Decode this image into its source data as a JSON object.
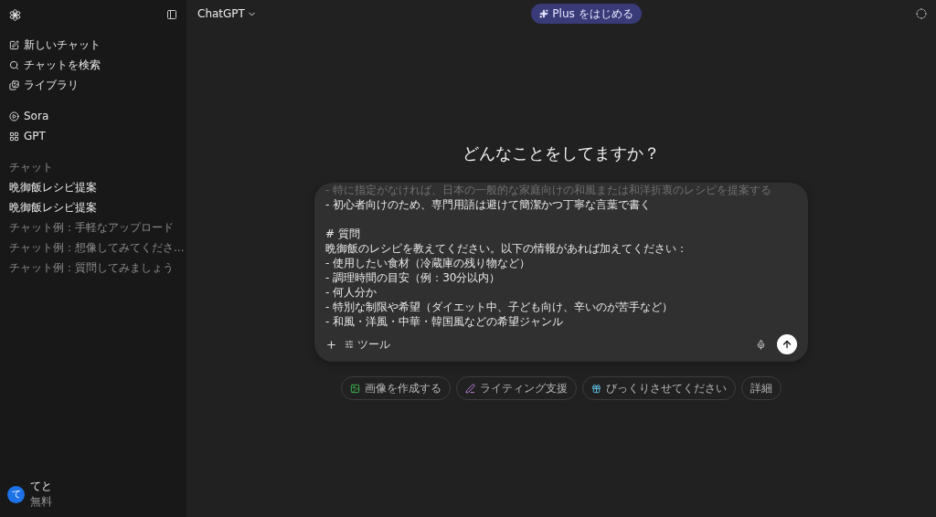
{
  "sidebar": {
    "nav": [
      {
        "label": "新しいチャット"
      },
      {
        "label": "チャットを検索"
      },
      {
        "label": "ライブラリ"
      }
    ],
    "apps": [
      {
        "label": "Sora"
      },
      {
        "label": "GPT"
      }
    ],
    "chats_heading": "チャット",
    "chats": [
      {
        "label": "晩御飯レシピ提案",
        "muted": false
      },
      {
        "label": "晩御飯レシピ提案",
        "muted": false
      },
      {
        "label": "チャット例：手軽なアップロード",
        "muted": true
      },
      {
        "label": "チャット例：想像してみてくださ...",
        "muted": true
      },
      {
        "label": "チャット例：質問してみましょう",
        "muted": true
      }
    ],
    "user": {
      "initial": "て",
      "name": "てと",
      "plan": "無料"
    }
  },
  "header": {
    "model": "ChatGPT",
    "upgrade": "Plus をはじめる"
  },
  "main": {
    "heading": "どんなことをしてますか？",
    "prompt_paragraphs": [
      [
        {
          "text": "- 特に指定がなければ、日本の一般的な家庭向けの和風または和洋折衷のレシピを提案する",
          "faded": true
        },
        {
          "text": "- 初心者向けのため、専門用語は避けて簡潔かつ丁寧な言葉で書く",
          "faded": false
        }
      ],
      [
        {
          "text": "# 質問",
          "faded": false
        },
        {
          "text": "晩御飯のレシピを教えてください。以下の情報があれば加えてください：",
          "faded": false
        },
        {
          "text": "- 使用したい食材（冷蔵庫の残り物など）",
          "faded": false
        },
        {
          "text": "- 調理時間の目安（例：30分以内）",
          "faded": false
        },
        {
          "text": "- 何人分か",
          "faded": false
        },
        {
          "text": "- 特別な制限や希望（ダイエット中、子ども向け、辛いのが苦手など）",
          "faded": false
        },
        {
          "text": "- 和風・洋風・中華・韓国風などの希望ジャンル",
          "faded": false
        }
      ]
    ],
    "tools_label": "ツール",
    "suggestions": [
      {
        "label": "画像を作成する"
      },
      {
        "label": "ライティング支援"
      },
      {
        "label": "びっくりさせてください"
      },
      {
        "label": "詳細"
      }
    ]
  }
}
